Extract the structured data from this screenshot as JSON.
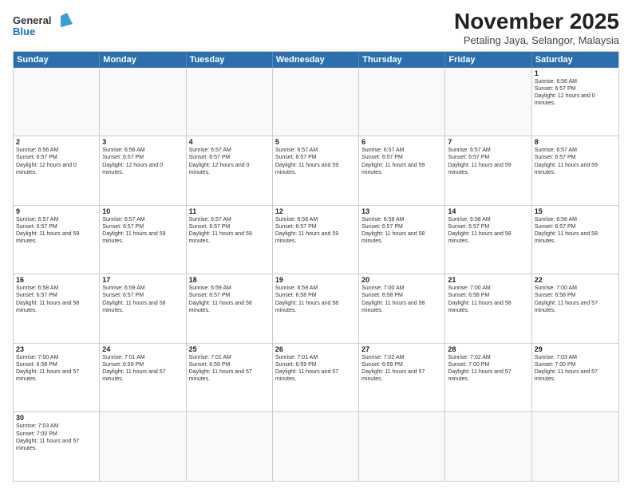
{
  "header": {
    "logo_general": "General",
    "logo_blue": "Blue",
    "month_title": "November 2025",
    "location": "Petaling Jaya, Selangor, Malaysia"
  },
  "days_of_week": [
    "Sunday",
    "Monday",
    "Tuesday",
    "Wednesday",
    "Thursday",
    "Friday",
    "Saturday"
  ],
  "weeks": [
    [
      {
        "day": "",
        "info": ""
      },
      {
        "day": "",
        "info": ""
      },
      {
        "day": "",
        "info": ""
      },
      {
        "day": "",
        "info": ""
      },
      {
        "day": "",
        "info": ""
      },
      {
        "day": "",
        "info": ""
      },
      {
        "day": "1",
        "info": "Sunrise: 6:56 AM\nSunset: 6:57 PM\nDaylight: 12 hours and 0 minutes."
      }
    ],
    [
      {
        "day": "2",
        "info": "Sunrise: 6:56 AM\nSunset: 6:57 PM\nDaylight: 12 hours and 0 minutes."
      },
      {
        "day": "3",
        "info": "Sunrise: 6:56 AM\nSunset: 6:57 PM\nDaylight: 12 hours and 0 minutes."
      },
      {
        "day": "4",
        "info": "Sunrise: 6:57 AM\nSunset: 6:57 PM\nDaylight: 12 hours and 0 minutes."
      },
      {
        "day": "5",
        "info": "Sunrise: 6:57 AM\nSunset: 6:57 PM\nDaylight: 11 hours and 59 minutes."
      },
      {
        "day": "6",
        "info": "Sunrise: 6:57 AM\nSunset: 6:57 PM\nDaylight: 11 hours and 59 minutes."
      },
      {
        "day": "7",
        "info": "Sunrise: 6:57 AM\nSunset: 6:57 PM\nDaylight: 11 hours and 59 minutes."
      },
      {
        "day": "8",
        "info": "Sunrise: 6:57 AM\nSunset: 6:57 PM\nDaylight: 11 hours and 59 minutes."
      }
    ],
    [
      {
        "day": "9",
        "info": "Sunrise: 6:57 AM\nSunset: 6:57 PM\nDaylight: 11 hours and 59 minutes."
      },
      {
        "day": "10",
        "info": "Sunrise: 6:57 AM\nSunset: 6:57 PM\nDaylight: 11 hours and 59 minutes."
      },
      {
        "day": "11",
        "info": "Sunrise: 6:57 AM\nSunset: 6:57 PM\nDaylight: 11 hours and 59 minutes."
      },
      {
        "day": "12",
        "info": "Sunrise: 6:58 AM\nSunset: 6:57 PM\nDaylight: 11 hours and 59 minutes."
      },
      {
        "day": "13",
        "info": "Sunrise: 6:58 AM\nSunset: 6:57 PM\nDaylight: 11 hours and 58 minutes."
      },
      {
        "day": "14",
        "info": "Sunrise: 6:58 AM\nSunset: 6:57 PM\nDaylight: 11 hours and 58 minutes."
      },
      {
        "day": "15",
        "info": "Sunrise: 6:58 AM\nSunset: 6:57 PM\nDaylight: 11 hours and 58 minutes."
      }
    ],
    [
      {
        "day": "16",
        "info": "Sunrise: 6:58 AM\nSunset: 6:57 PM\nDaylight: 11 hours and 58 minutes."
      },
      {
        "day": "17",
        "info": "Sunrise: 6:59 AM\nSunset: 6:57 PM\nDaylight: 11 hours and 58 minutes."
      },
      {
        "day": "18",
        "info": "Sunrise: 6:59 AM\nSunset: 6:57 PM\nDaylight: 11 hours and 58 minutes."
      },
      {
        "day": "19",
        "info": "Sunrise: 6:59 AM\nSunset: 6:58 PM\nDaylight: 11 hours and 58 minutes."
      },
      {
        "day": "20",
        "info": "Sunrise: 7:00 AM\nSunset: 6:58 PM\nDaylight: 11 hours and 58 minutes."
      },
      {
        "day": "21",
        "info": "Sunrise: 7:00 AM\nSunset: 6:58 PM\nDaylight: 11 hours and 58 minutes."
      },
      {
        "day": "22",
        "info": "Sunrise: 7:00 AM\nSunset: 6:58 PM\nDaylight: 11 hours and 57 minutes."
      }
    ],
    [
      {
        "day": "23",
        "info": "Sunrise: 7:00 AM\nSunset: 6:58 PM\nDaylight: 11 hours and 57 minutes."
      },
      {
        "day": "24",
        "info": "Sunrise: 7:01 AM\nSunset: 6:59 PM\nDaylight: 11 hours and 57 minutes."
      },
      {
        "day": "25",
        "info": "Sunrise: 7:01 AM\nSunset: 6:59 PM\nDaylight: 11 hours and 57 minutes."
      },
      {
        "day": "26",
        "info": "Sunrise: 7:01 AM\nSunset: 6:59 PM\nDaylight: 11 hours and 57 minutes."
      },
      {
        "day": "27",
        "info": "Sunrise: 7:02 AM\nSunset: 6:59 PM\nDaylight: 11 hours and 57 minutes."
      },
      {
        "day": "28",
        "info": "Sunrise: 7:02 AM\nSunset: 7:00 PM\nDaylight: 11 hours and 57 minutes."
      },
      {
        "day": "29",
        "info": "Sunrise: 7:03 AM\nSunset: 7:00 PM\nDaylight: 11 hours and 57 minutes."
      }
    ],
    [
      {
        "day": "30",
        "info": "Sunrise: 7:03 AM\nSunset: 7:00 PM\nDaylight: 11 hours and 57 minutes."
      },
      {
        "day": "",
        "info": ""
      },
      {
        "day": "",
        "info": ""
      },
      {
        "day": "",
        "info": ""
      },
      {
        "day": "",
        "info": ""
      },
      {
        "day": "",
        "info": ""
      },
      {
        "day": "",
        "info": ""
      }
    ]
  ]
}
